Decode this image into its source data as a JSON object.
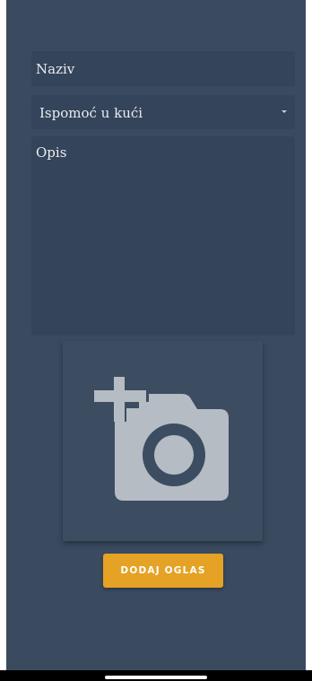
{
  "form": {
    "title_placeholder": "Naziv",
    "category_selected": "Ispomoć u kući",
    "description_placeholder": "Opis"
  },
  "image_picker": {
    "icon": "add-photo-icon"
  },
  "submit_label": "DODAJ OGLAS",
  "colors": {
    "background": "#3a4b60",
    "field": "#34445a",
    "accent": "#e5a224",
    "icon": "#b6bcc4"
  }
}
